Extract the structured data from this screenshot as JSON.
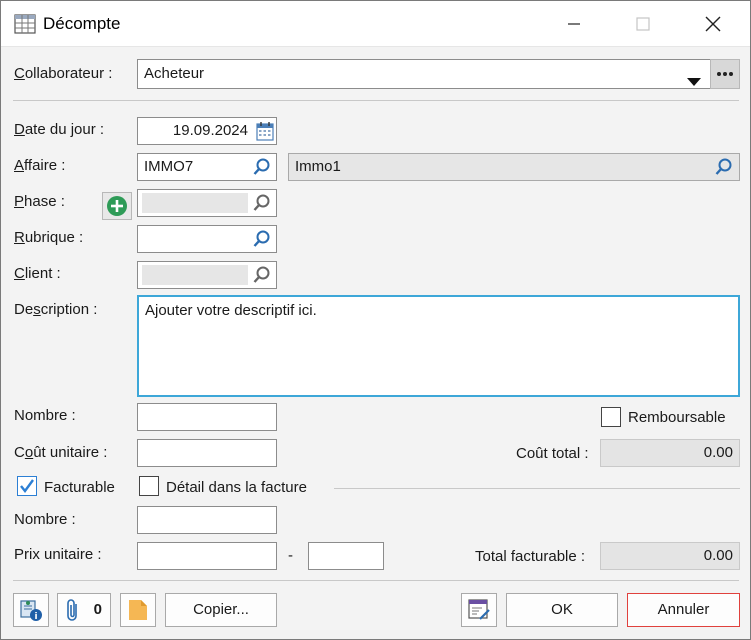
{
  "window": {
    "title": "Décompte"
  },
  "icons": {
    "app": "grid-table-icon",
    "minimize": "minimize-icon",
    "maximize": "maximize-icon",
    "close": "close-icon",
    "search": "magnifier-icon",
    "calendar": "calendar-icon",
    "add": "plus-circle-icon",
    "dropdown": "chevron-down-icon",
    "more": "ellipsis-icon"
  },
  "colors": {
    "accent": "#3da7d8",
    "check": "#2c7fd4",
    "add_green": "#2e9b57",
    "cancel_border": "#e0413d",
    "folder": "#f5b754"
  },
  "collaborateur": {
    "label_pre": "",
    "label_u": "C",
    "label_post": "ollaborateur :",
    "value": "Acheteur"
  },
  "date": {
    "label_pre": "",
    "label_u": "D",
    "label_post": "ate du jour :",
    "value": "19.09.2024"
  },
  "affaire": {
    "label_pre": "",
    "label_u": "A",
    "label_post": "ffaire :",
    "code": "IMMO7",
    "name": "Immo1"
  },
  "phase": {
    "label_pre": "",
    "label_u": "P",
    "label_post": "hase :",
    "value": ""
  },
  "rubrique": {
    "label_pre": "",
    "label_u": "R",
    "label_post": "ubrique :",
    "value": ""
  },
  "client": {
    "label_pre": "",
    "label_u": "C",
    "label_post": "lient :",
    "value": ""
  },
  "description": {
    "label_pre": "De",
    "label_u": "s",
    "label_post": "cription :",
    "placeholder": "Ajouter votre descriptif ici."
  },
  "cost": {
    "nombre_label": "Nombre :",
    "nombre_value": "",
    "cout_unitaire_label_pre": "C",
    "cout_unitaire_label_u": "o",
    "cout_unitaire_label_post": "ût unitaire :",
    "cout_unitaire_value": "",
    "remboursable_label": "Remboursable",
    "remboursable_checked": false,
    "cout_total_label": "Coût total :",
    "cout_total_value": "0.00"
  },
  "billing": {
    "facturable_label": "Facturable",
    "facturable_checked": true,
    "detail_label": "Détail dans la facture",
    "detail_checked": false,
    "nombre_label": "Nombre :",
    "nombre_value": "",
    "prix_unitaire_label": "Prix unitaire :",
    "prix_value": "",
    "dash": "-",
    "prix_extra_value": "",
    "total_label": "Total facturable :",
    "total_value": "0.00"
  },
  "footer": {
    "attachments_count": "0",
    "copy_label": "Copier...",
    "ok_label": "OK",
    "cancel_label": "Annuler"
  }
}
